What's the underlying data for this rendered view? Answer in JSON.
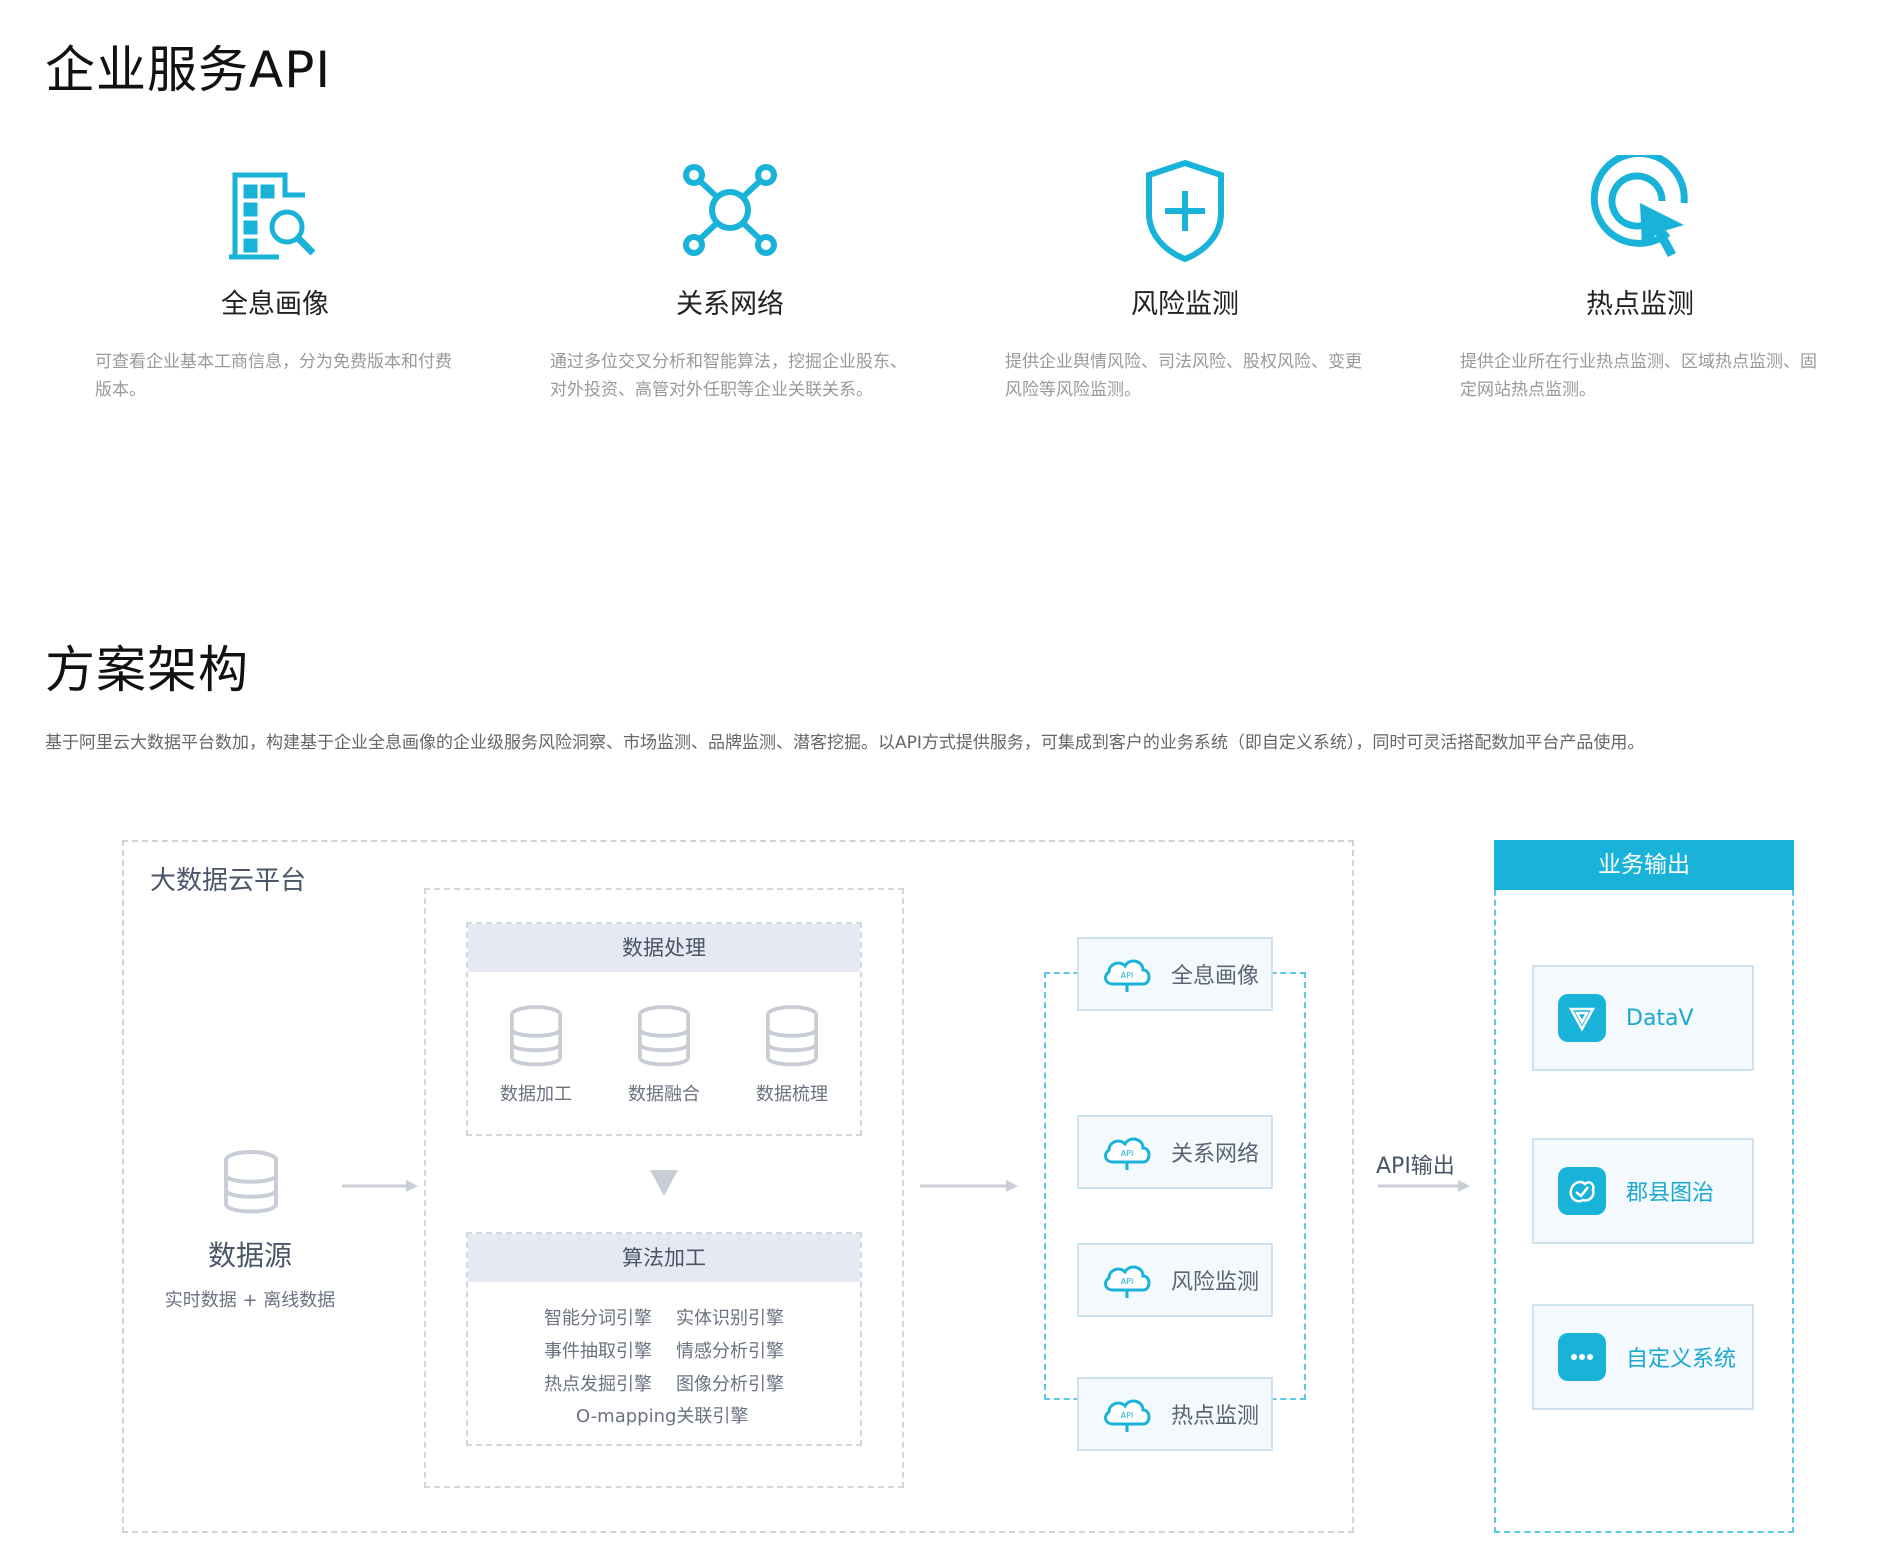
{
  "section1": {
    "title": "企业服务API",
    "features": [
      {
        "icon": "building-search-icon",
        "title": "全息画像",
        "desc": "可查看企业基本工商信息，分为免费版本和付费版本。"
      },
      {
        "icon": "network-nodes-icon",
        "title": "关系网络",
        "desc": "通过多位交叉分析和智能算法，挖掘企业股东、对外投资、高管对外任职等企业关联关系。"
      },
      {
        "icon": "shield-plus-icon",
        "title": "风险监测",
        "desc": "提供企业舆情风险、司法风险、股权风险、变更风险等风险监测。"
      },
      {
        "icon": "target-cursor-icon",
        "title": "热点监测",
        "desc": "提供企业所在行业热点监测、区域热点监测、固定网站热点监测。"
      }
    ]
  },
  "section2": {
    "title": "方案架构",
    "intro": "基于阿里云大数据平台数加，构建基于企业全息画像的企业级服务风险洞察、市场监测、品牌监测、潜客挖掘。以API方式提供服务，可集成到客户的业务系统（即自定义系统），同时可灵活搭配数加平台产品使用。"
  },
  "diagram": {
    "platform_label": "大数据云平台",
    "source": {
      "title": "数据源",
      "subtitle": "实时数据 + 离线数据"
    },
    "processing": {
      "title": "数据处理",
      "items": [
        "数据加工",
        "数据融合",
        "数据梳理"
      ]
    },
    "algorithm": {
      "title": "算法加工",
      "rows": [
        [
          "智能分词引擎",
          "实体识别引擎"
        ],
        [
          "事件抽取引擎",
          "情感分析引擎"
        ],
        [
          "热点发掘引擎",
          "图像分析引擎"
        ]
      ],
      "last": "O-mapping关联引擎"
    },
    "api_cards": [
      "全息画像",
      "关系网络",
      "风险监测",
      "热点监测"
    ],
    "api_badge": "API",
    "api_output_label": "API输出",
    "output": {
      "title": "业务输出",
      "items": [
        {
          "label": "DataV",
          "icon": "datav-icon"
        },
        {
          "label": "郡县图治",
          "icon": "county-map-icon"
        },
        {
          "label": "自定义系统",
          "icon": "more-dots-icon"
        }
      ]
    },
    "colors": {
      "accent": "#19b3d9",
      "dashed_gray": "#cfd3da",
      "panel_head": "#e6e9f2"
    }
  }
}
